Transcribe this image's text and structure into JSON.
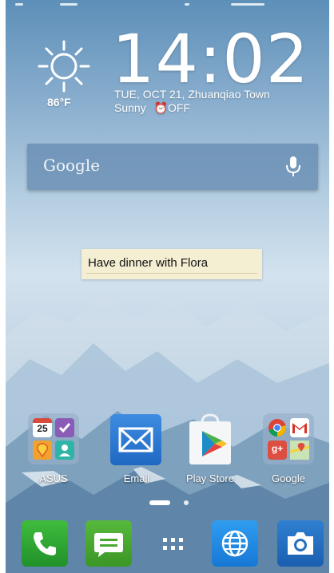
{
  "clock": {
    "time": "14:02",
    "date_location": "TUE, OCT 21, Zhuanqiao Town",
    "condition": "Sunny",
    "alarm": "OFF",
    "temperature": "86°F",
    "weather_icon": "sun-icon"
  },
  "search": {
    "label": "Google",
    "mic_icon": "microphone-icon"
  },
  "memo": {
    "text": "Have dinner with Flora"
  },
  "apps": [
    {
      "label": "ASUS",
      "icon": "folder-icon"
    },
    {
      "label": "Email",
      "icon": "email-icon"
    },
    {
      "label": "Play Store",
      "icon": "play-store-icon"
    },
    {
      "label": "Google",
      "icon": "folder-icon"
    }
  ],
  "asus_folder": {
    "calendar_day": "25"
  },
  "pager": {
    "page_count": 2,
    "current_page": 1
  },
  "dock": [
    {
      "icon": "phone-icon"
    },
    {
      "icon": "messaging-icon"
    },
    {
      "icon": "app-drawer-icon"
    },
    {
      "icon": "browser-icon"
    },
    {
      "icon": "camera-icon"
    }
  ],
  "colors": {
    "phone": "#2fa833",
    "messaging": "#49a830",
    "browser": "#2189e3",
    "camera": "#2470c0",
    "email": "#2c7ad4",
    "memo": "#f4efd3"
  }
}
